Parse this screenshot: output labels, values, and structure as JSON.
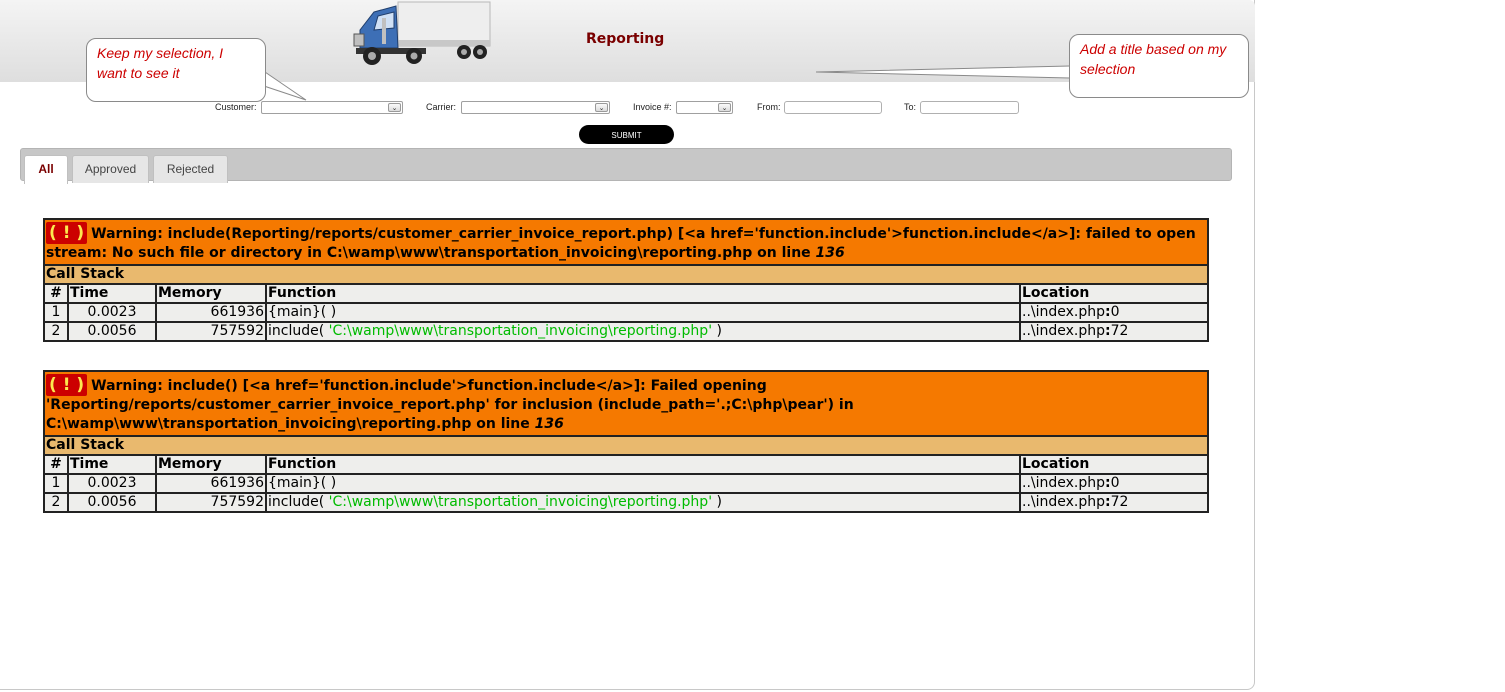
{
  "header": {
    "title": "Reporting",
    "logo_icon": "truck-icon"
  },
  "callouts": {
    "left": "Keep my selection, I want to see it",
    "right": "Add a title based on my selection"
  },
  "filters": {
    "customer_label": "Customer:",
    "customer_value": "",
    "carrier_label": "Carrier:",
    "carrier_value": "",
    "invoice_label": "Invoice #:",
    "invoice_value": "",
    "from_label": "From:",
    "from_value": "",
    "to_label": "To:",
    "to_value": "",
    "submit_label": "SUBMIT"
  },
  "tabs": [
    {
      "label": "All",
      "active": true
    },
    {
      "label": "Approved",
      "active": false
    },
    {
      "label": "Rejected",
      "active": false
    }
  ],
  "errors": [
    {
      "icon": "( ! )",
      "message_main": "Warning: include(Reporting/reports/customer_carrier_invoice_report.php) [<a href='function.include'>function.include</a>]: failed to open stream: No such file or directory in C:\\wamp\\www\\transportation_invoicing\\reporting.php on line ",
      "line": "136",
      "call_stack_title": "Call Stack",
      "columns": [
        "#",
        "Time",
        "Memory",
        "Function",
        "Location"
      ],
      "rows": [
        {
          "num": "1",
          "time": "0.0023",
          "memory": "661936",
          "function": "{main}( )",
          "arg": "",
          "function_end": "",
          "location_file": "..\\index.php",
          "location_sep": ":",
          "location_line": "0"
        },
        {
          "num": "2",
          "time": "0.0056",
          "memory": "757592",
          "function": "include( ",
          "arg": "'C:\\wamp\\www\\transportation_invoicing\\reporting.php'",
          "function_end": " )",
          "location_file": "..\\index.php",
          "location_sep": ":",
          "location_line": "72"
        }
      ]
    },
    {
      "icon": "( ! )",
      "message_main": "Warning: include() [<a href='function.include'>function.include</a>]: Failed opening 'Reporting/reports/customer_carrier_invoice_report.php' for inclusion (include_path='.;C:\\php\\pear') in C:\\wamp\\www\\transportation_invoicing\\reporting.php on line ",
      "line": "136",
      "call_stack_title": "Call Stack",
      "columns": [
        "#",
        "Time",
        "Memory",
        "Function",
        "Location"
      ],
      "rows": [
        {
          "num": "1",
          "time": "0.0023",
          "memory": "661936",
          "function": "{main}( )",
          "arg": "",
          "function_end": "",
          "location_file": "..\\index.php",
          "location_sep": ":",
          "location_line": "0"
        },
        {
          "num": "2",
          "time": "0.0056",
          "memory": "757592",
          "function": "include( ",
          "arg": "'C:\\wamp\\www\\transportation_invoicing\\reporting.php'",
          "function_end": " )",
          "location_file": "..\\index.php",
          "location_sep": ":",
          "location_line": "72"
        }
      ]
    }
  ]
}
